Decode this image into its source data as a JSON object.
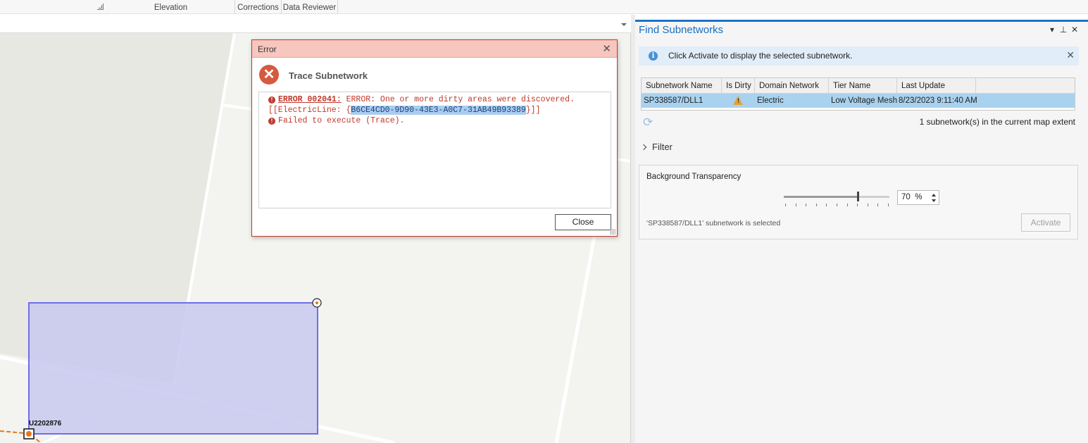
{
  "ribbon": {
    "groups": [
      "Elevation",
      "Corrections",
      "Data Reviewer"
    ]
  },
  "map": {
    "feature_label": "U2202876"
  },
  "error_dialog": {
    "title": "Error",
    "heading": "Trace Subnetwork",
    "messages": {
      "code": "ERROR 002041:",
      "line1_text": " ERROR: One or more dirty areas were discovered.",
      "line2_prefix": "[[ElectricLine: {",
      "line2_guid": "B6CE4CD0-9D90-43E3-A0C7-31AB49B93389",
      "line2_suffix": "}]]",
      "line3_text": "Failed to execute (Trace)."
    },
    "close_label": "Close"
  },
  "pane": {
    "title": "Find Subnetworks",
    "info_message": "Click Activate to display the selected subnetwork.",
    "table": {
      "headers": [
        "Subnetwork Name",
        "Is Dirty",
        "Domain Network",
        "Tier Name",
        "Last Update"
      ],
      "row": {
        "subnetwork_name": "SP338587/DLL1",
        "is_dirty": "warning",
        "domain_network": "Electric",
        "tier_name": "Low Voltage Mesh",
        "last_update": "8/23/2023 9:11:40 AM"
      }
    },
    "count_text": "1 subnetwork(s) in the current map extent",
    "filter_label": "Filter",
    "background": {
      "label": "Background Transparency",
      "value_percent": 70,
      "value_text": "70",
      "unit": "%",
      "status": "'SP338587/DLL1' subnetwork is selected",
      "activate_label": "Activate"
    }
  },
  "colors": {
    "accent": "#1a6fc4",
    "error": "#c0392b",
    "selection": "#a9d2ef",
    "polygon_fill": "#c8c8f0",
    "polygon_stroke": "#6e6ee6"
  }
}
